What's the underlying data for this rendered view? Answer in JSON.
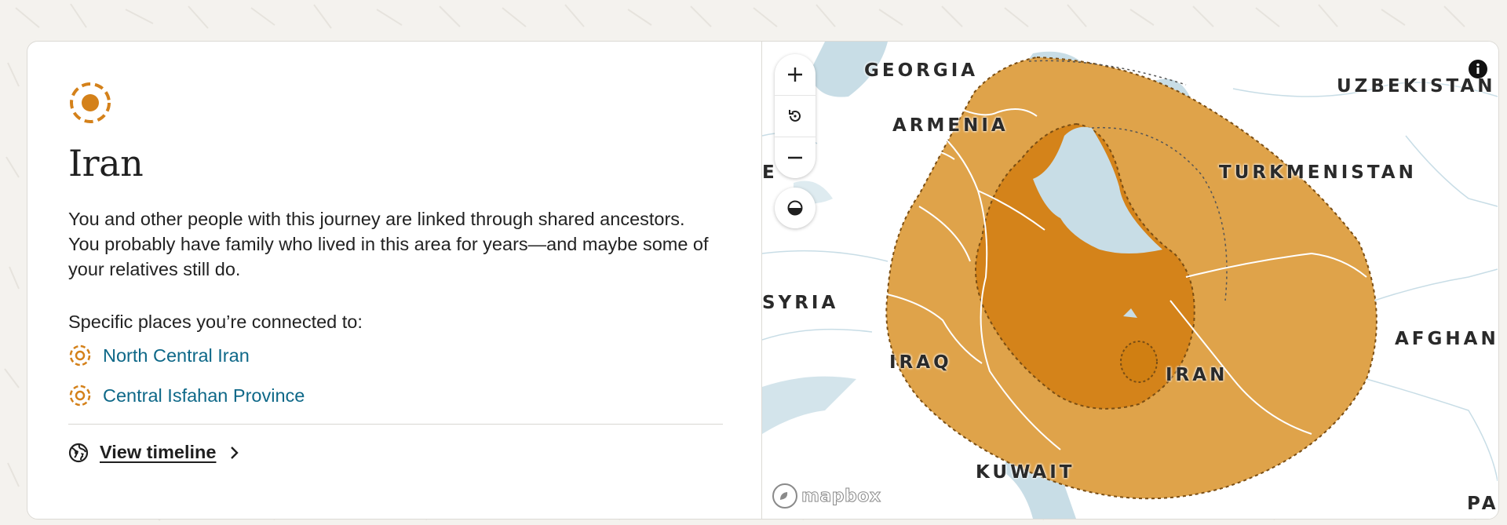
{
  "panel": {
    "title": "Iran",
    "description": "You and other people with this journey are linked through shared ancestors. You probably have family who lived in this area for years—and maybe some of your relatives still do.",
    "places_heading": "Specific places you’re connected to:",
    "places": [
      {
        "label": "North Central Iran",
        "icon": "region-target-icon"
      },
      {
        "label": "Central Isfahan Province",
        "icon": "region-target-icon"
      }
    ],
    "timeline_label": "View timeline"
  },
  "map": {
    "labels": {
      "georgia": "GEORGIA",
      "armenia": "ARMENIA",
      "uzbekistan": "UZBEKISTAN",
      "turkmenistan": "TURKMENISTAN",
      "syria": "SYRIA",
      "iraq": "IRAQ",
      "iran": "IRAN",
      "afghanistan": "AFGHAN",
      "kuwait": "KUWAIT",
      "pakistan": "PA",
      "cut_left": "E"
    },
    "attribution": "mapbox",
    "controls": [
      "zoom-in",
      "reset-rotation",
      "zoom-out",
      "contrast-toggle",
      "info"
    ]
  },
  "colors": {
    "accent_orange": "#d4811a",
    "outer_region": "#dfa34a",
    "inner_region": "#d4831a",
    "water": "#c8dde6",
    "link": "#0e6888"
  }
}
